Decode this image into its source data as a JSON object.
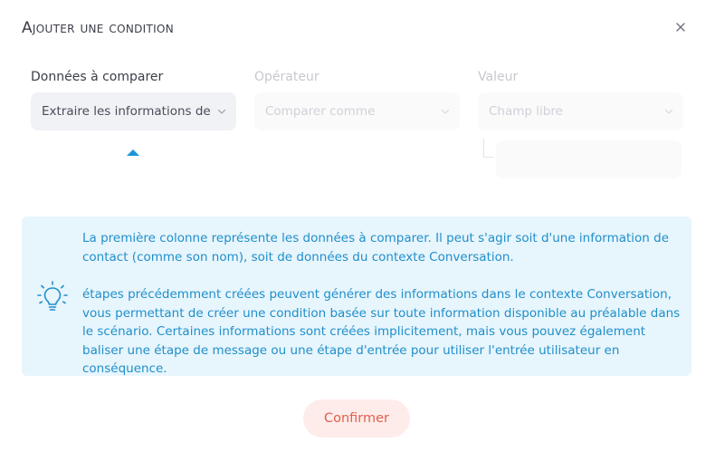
{
  "dialog": {
    "title": "Ajouter une condition",
    "close_icon": "close-icon"
  },
  "columns": [
    {
      "label": "Données à comparer",
      "state": "active",
      "value": "Extraire les informations de"
    },
    {
      "label": "Opérateur",
      "state": "disabled",
      "value": "Comparer comme"
    },
    {
      "label": "Valeur",
      "state": "disabled",
      "value": "Champ libre"
    }
  ],
  "info": {
    "icon": "lightbulb-icon",
    "paragraph_1": "La première colonne représente les données à comparer. Il peut s'agir soit d'une information de contact (comme son nom), soit de données du contexte Conversation.",
    "paragraph_2": "étapes précédemment créées peuvent générer des informations dans le contexte Conversation, vous permettant de créer une condition basée sur toute information disponible au préalable dans le scénario. Certaines informations sont créées implicitement, mais vous pouvez également baliser une étape de message ou une étape d'entrée pour utiliser l'entrée utilisateur en conséquence."
  },
  "actions": {
    "confirm_label": "Confirmer"
  },
  "colors": {
    "accent_blue": "#1f8fcb",
    "info_background": "#e7f5fc",
    "confirm_text": "#e2604f",
    "confirm_background": "#fdecea"
  }
}
